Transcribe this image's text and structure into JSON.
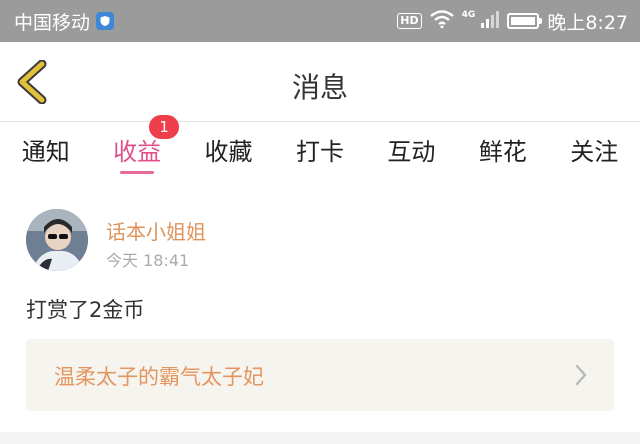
{
  "status_bar": {
    "carrier": "中国移动",
    "hd": "HD",
    "network": "4G",
    "time": "晚上8:27"
  },
  "nav": {
    "title": "消息",
    "back_icon": "chevron-left-icon"
  },
  "tabs": [
    {
      "label": "通知",
      "active": false
    },
    {
      "label": "收益",
      "active": true,
      "badge": "1"
    },
    {
      "label": "收藏",
      "active": false
    },
    {
      "label": "打卡",
      "active": false
    },
    {
      "label": "互动",
      "active": false
    },
    {
      "label": "鲜花",
      "active": false
    },
    {
      "label": "关注",
      "active": false
    }
  ],
  "message": {
    "sender": "话本小姐姐",
    "time": "今天 18:41",
    "content": "打赏了2金币",
    "book_title": "温柔太子的霸气太子妃"
  },
  "colors": {
    "accent_pink": "#e0508a",
    "badge_red": "#ee3e4b",
    "sender_orange": "#e0935c",
    "back_chevron": "#e2c03a"
  }
}
